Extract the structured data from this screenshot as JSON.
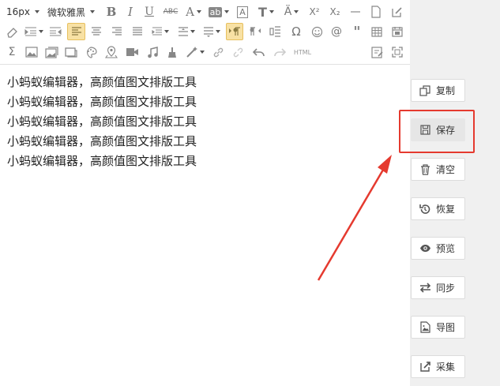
{
  "toolbar": {
    "font_size": "16px",
    "font_family": "微软雅黑",
    "rows": [
      [
        "bold-icon",
        "italic-icon",
        "underline-icon",
        "strikethrough-icon",
        "font-color-icon",
        "highlight-icon",
        "border-text-icon",
        "title-icon",
        "font-size-icon",
        "superscript-icon",
        "subscript-icon",
        "horizontal-rule-icon",
        "new-doc-icon",
        "edit-icon"
      ],
      [
        "eraser-icon",
        "indent-icon",
        "outdent-icon",
        "align-left-icon",
        "align-center-icon",
        "align-right-icon",
        "justify-icon",
        "letter-spacing-icon",
        "line-height-icon",
        "paragraph-spacing-icon",
        "ltr-icon",
        "rtl-icon",
        "table-icon",
        "omega-icon",
        "emoji-icon",
        "at-icon",
        "quote-icon",
        "grid-icon",
        "calendar-icon"
      ],
      [
        "sum-icon",
        "image-icon",
        "image-gallery-icon",
        "video-frame-icon",
        "palette-icon",
        "map-pin-icon",
        "video-icon",
        "music-icon",
        "brush-icon",
        "magic-icon",
        "link-icon",
        "unlink-icon",
        "undo-icon",
        "redo-icon",
        "html-icon",
        "note-icon",
        "fullscreen-icon"
      ]
    ],
    "html_label": "HTML"
  },
  "content": {
    "lines": [
      "小蚂蚁编辑器，高颜值图文排版工具",
      "小蚂蚁编辑器，高颜值图文排版工具",
      "小蚂蚁编辑器，高颜值图文排版工具",
      "小蚂蚁编辑器，高颜值图文排版工具",
      "小蚂蚁编辑器，高颜值图文排版工具"
    ]
  },
  "sidebar": {
    "buttons": [
      {
        "label": "复制",
        "icon": "copy-icon"
      },
      {
        "label": "保存",
        "icon": "save-icon"
      },
      {
        "label": "清空",
        "icon": "trash-icon"
      },
      {
        "label": "恢复",
        "icon": "restore-icon"
      },
      {
        "label": "预览",
        "icon": "eye-icon"
      },
      {
        "label": "同步",
        "icon": "sync-icon"
      },
      {
        "label": "导图",
        "icon": "export-image-icon"
      },
      {
        "label": "采集",
        "icon": "collect-icon"
      }
    ]
  },
  "colors": {
    "annotation": "#e53a2f",
    "active_button": "#f8e1a4",
    "sidebar_bg": "#f0f0f0"
  }
}
